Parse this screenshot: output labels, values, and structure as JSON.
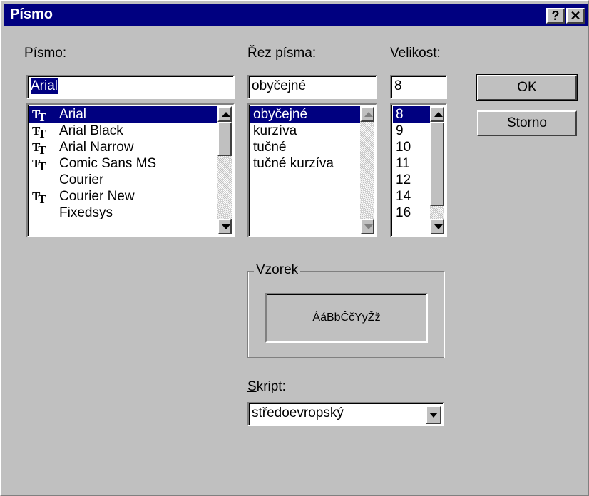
{
  "window": {
    "title": "Písmo",
    "help_label": "?",
    "close_label": "✕"
  },
  "font": {
    "label_first": "P",
    "label_rest": "ísmo:",
    "value": "Arial",
    "items": [
      {
        "name": "Arial",
        "icon": "truetype-icon"
      },
      {
        "name": "Arial Black",
        "icon": "truetype-icon"
      },
      {
        "name": "Arial Narrow",
        "icon": "truetype-icon"
      },
      {
        "name": "Comic Sans MS",
        "icon": "truetype-icon"
      },
      {
        "name": "Courier",
        "icon": ""
      },
      {
        "name": "Courier New",
        "icon": "truetype-icon"
      },
      {
        "name": "Fixedsys",
        "icon": ""
      }
    ],
    "selected_index": 0
  },
  "style": {
    "label_pre": "Ře",
    "label_u": "z",
    "label_post": " písma:",
    "value": "obyčejné",
    "items": [
      "obyčejné",
      "kurzíva",
      "tučné",
      "tučné kurzíva"
    ],
    "selected_index": 0
  },
  "size": {
    "label_pre": "Ve",
    "label_u": "l",
    "label_post": "ikost:",
    "value": "8",
    "items": [
      "8",
      "9",
      "10",
      "11",
      "12",
      "14",
      "16"
    ],
    "selected_index": 0
  },
  "buttons": {
    "ok": "OK",
    "cancel": "Storno"
  },
  "sample": {
    "title": "Vzorek",
    "text": "ÁáBbČčYyŽž"
  },
  "script": {
    "label_u": "S",
    "label_rest": "kript:",
    "value": "středoevropský"
  },
  "colors": {
    "titlebar": "#000080",
    "face": "#c0c0c0",
    "selection": "#000080"
  }
}
